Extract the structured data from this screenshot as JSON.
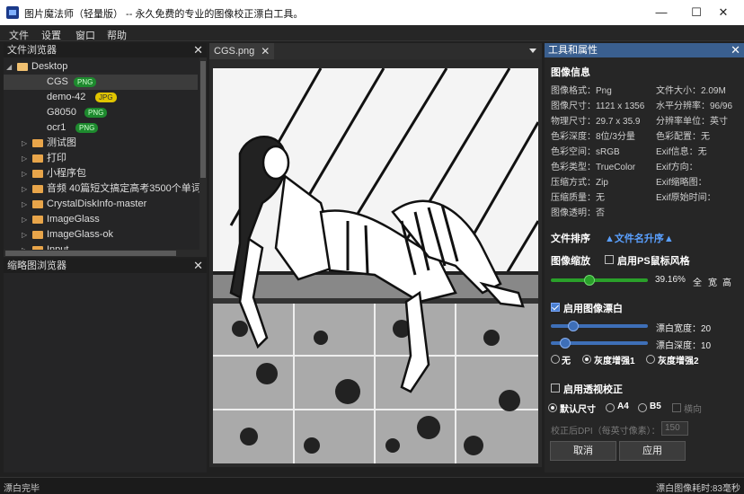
{
  "window": {
    "title": "图片魔法师（轻量版） -- 永久免费的专业的图像校正漂白工具。",
    "minimize": "—",
    "maximize": "☐",
    "close": "✕"
  },
  "menu": [
    "文件",
    "设置",
    "窗口",
    "帮助"
  ],
  "file_browser": {
    "title": "文件浏览器",
    "close": "✕",
    "root": "Desktop",
    "files": [
      {
        "name": "CGS",
        "badge": "PNG"
      },
      {
        "name": "demo-42",
        "badge": "JPG"
      },
      {
        "name": "G8050",
        "badge": "PNG"
      },
      {
        "name": "ocr1",
        "badge": "PNG"
      }
    ],
    "folders": [
      "测试图",
      "打印",
      "小程序包",
      "音频 40篇短文搞定高考3500个单词",
      "CrystalDiskInfo-master",
      "ImageGlass",
      "ImageGlass-ok",
      "Input"
    ]
  },
  "thumbnail_browser": {
    "title": "缩略图浏览器",
    "close": "✕"
  },
  "tab": {
    "label": "CGS.png",
    "close": "✕"
  },
  "properties": {
    "title": "工具和属性",
    "close": "✕",
    "image_info_title": "图像信息",
    "info_left": [
      "图像格式：Png",
      "图像尺寸：1121 x 1356",
      "物理尺寸：29.7 x 35.9",
      "色彩深度：8位/3分量",
      "色彩空间：sRGB",
      "色彩类型：TrueColor",
      "压缩方式：Zip",
      "压缩质量：无",
      "图像透明：否"
    ],
    "info_right": [
      "文件大小：2.09M",
      "水平分辨率：96/96",
      "分辨率单位：英寸",
      "色彩配置：无",
      "Exif信息：无",
      "Exif方向：",
      "Exif缩略图：",
      "Exif原始时间："
    ],
    "sort_label": "文件排序",
    "sort_value": "▲文件名升序▲",
    "zoom_label": "图像缩放",
    "ps_mouse_label": "启用PS鼠标风格",
    "zoom": {
      "percent": "39.16%",
      "full": "全",
      "width": "宽",
      "height": "高",
      "level": 0.39
    },
    "whiten": {
      "label": "启用图像漂白",
      "width_label": "漂白宽度：20",
      "depth_label": "漂白深度：10",
      "width_level": 0.2,
      "depth_level": 0.1,
      "opt_none": "无",
      "opt_gray1": "灰度增强1",
      "opt_gray2": "灰度增强2"
    },
    "perspective": {
      "label": "启用透视校正",
      "size_default": "默认尺寸",
      "size_a4": "A4",
      "size_b5": "B5",
      "landscape": "横向",
      "dpi_label": "校正后DPI（每英寸像素）：",
      "dpi_value": "150"
    },
    "cancel": "取消",
    "apply": "应用"
  },
  "status": {
    "left": "漂白完毕",
    "right": "漂白图像耗时:83毫秒"
  },
  "colors": {
    "accent": "#3a5f8f",
    "green_slider": "#2aa02a",
    "blue_slider": "#3e6fb8",
    "link": "#5aa0ff"
  }
}
